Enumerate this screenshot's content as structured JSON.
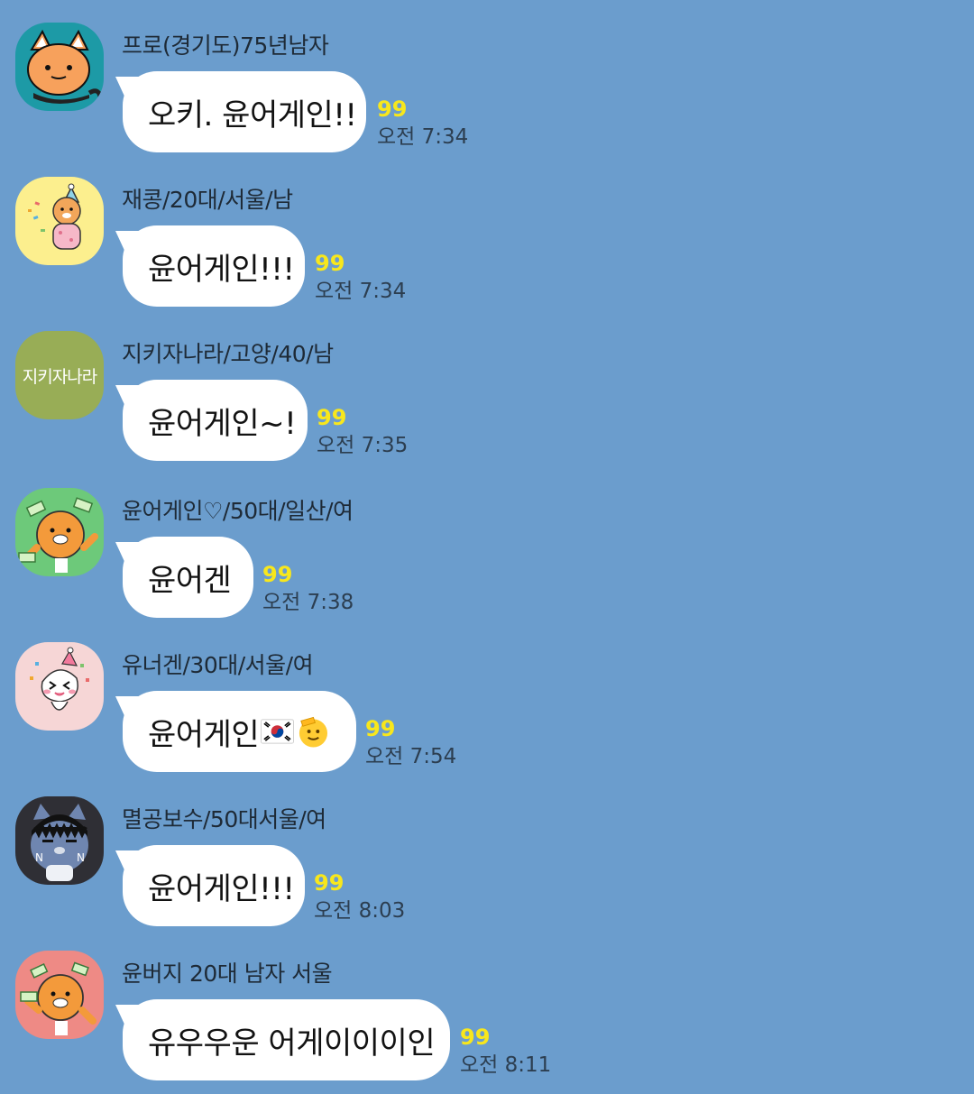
{
  "messages": [
    {
      "sender": "프로(경기도)75년남자",
      "text": "오키. 윤어게인!!",
      "read_count": "99",
      "time": "오전 7:34",
      "avatar": {
        "icon": "raccoon-character-icon",
        "bg": "#1d9aa6"
      }
    },
    {
      "sender": "재콩/20대/서울/남",
      "text": "윤어게인!!!",
      "read_count": "99",
      "time": "오전 7:34",
      "avatar": {
        "icon": "party-lion-character-icon",
        "bg": "#fcef8e"
      }
    },
    {
      "sender": "지키자나라/고양/40/남",
      "text": "윤어게인~!",
      "read_count": "99",
      "time": "오전 7:35",
      "avatar": {
        "icon": "text-avatar",
        "label": "지키자나라",
        "bg": "#98ad56"
      }
    },
    {
      "sender": "윤어게인♡/50대/일산/여",
      "text": "윤어겐",
      "read_count": "99",
      "time": "오전 7:38",
      "avatar": {
        "icon": "money-lion-character-icon",
        "bg": "#6dc97a"
      }
    },
    {
      "sender": "유너겐/30대/서울/여",
      "text": "윤어게인",
      "emojis": [
        "korea-flag-emoji",
        "saluting-face-emoji"
      ],
      "read_count": "99",
      "time": "오전 7:54",
      "avatar": {
        "icon": "party-peach-character-icon",
        "bg": "#f6d6d6"
      }
    },
    {
      "sender": "멸공보수/50대서울/여",
      "text": "윤어게인!!!",
      "read_count": "99",
      "time": "오전 8:03",
      "avatar": {
        "icon": "cat-character-icon",
        "bg": "#2f2f35"
      }
    },
    {
      "sender": "윤버지 20대 남자 서울",
      "text": "유우우운 어게이이이인",
      "read_count": "99",
      "time": "오전 8:11",
      "avatar": {
        "icon": "money-lion-character-icon",
        "bg": "#ee8a85"
      }
    }
  ],
  "colors": {
    "background": "#6b9dcd",
    "bubble": "#ffffff",
    "read_count": "#f8e71c"
  }
}
